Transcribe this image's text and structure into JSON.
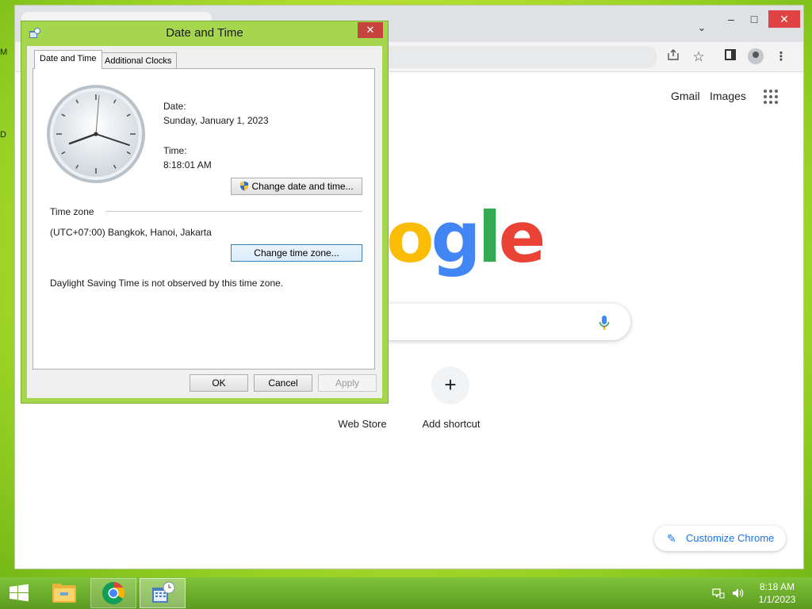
{
  "desktop": {
    "fragments": [
      "M",
      "D"
    ]
  },
  "chrome": {
    "titlebar": {
      "minimize_icon": "minimize-icon",
      "maximize_icon": "maximize-icon",
      "close_icon": "close-icon"
    },
    "toolbar_icons": [
      "share-icon",
      "star-icon",
      "side-panel-icon",
      "profile-icon",
      "menu-icon"
    ],
    "ntp": {
      "gmail": "Gmail",
      "images": "Images",
      "logo_visible": "ogle",
      "shortcuts": [
        {
          "label": "Web Store"
        },
        {
          "label": "Add shortcut",
          "icon": "+"
        }
      ],
      "customize": "Customize Chrome"
    },
    "colors": {
      "google_blue": "#4285F4",
      "google_red": "#EA4335",
      "google_yellow": "#FBBC05",
      "google_green": "#34A853",
      "link_blue": "#1a73e8"
    }
  },
  "dialog": {
    "title": "Date and Time",
    "close_label": "✕",
    "tabs": [
      {
        "label": "Date and Time",
        "selected": true
      },
      {
        "label": "Additional Clocks",
        "selected": false
      }
    ],
    "date_label": "Date:",
    "date_value": "Sunday, January 1, 2023",
    "time_label": "Time:",
    "time_value": "8:18:01 AM",
    "change_datetime_button": "Change date and time...",
    "timezone_heading": "Time zone",
    "timezone_value": "(UTC+07:00) Bangkok, Hanoi, Jakarta",
    "change_timezone_button": "Change time zone...",
    "dst_note": "Daylight Saving Time is not observed by this time zone.",
    "ok_button": "OK",
    "cancel_button": "Cancel",
    "apply_button": "Apply",
    "accent_color": "#a6d64e"
  },
  "taskbar": {
    "apps": [
      "file-explorer",
      "google-chrome",
      "date-and-time"
    ],
    "clock_time": "8:18 AM",
    "clock_date": "1/1/2023"
  }
}
